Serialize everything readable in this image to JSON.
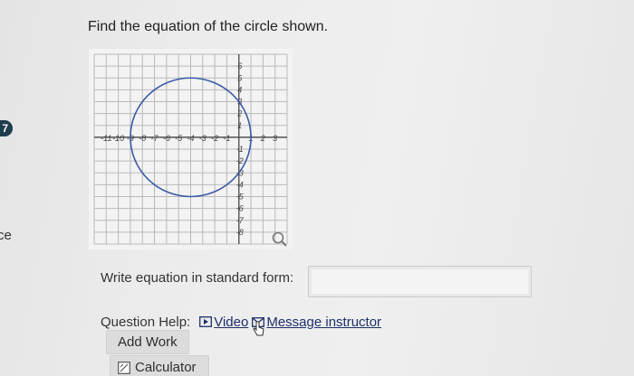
{
  "side_badge": "7",
  "side_text": "ce",
  "question": {
    "title": "Find the equation of the circle shown."
  },
  "graph": {
    "x_ticks": [
      "-11",
      "-10",
      "-9",
      "-8",
      "-7",
      "-6",
      "-5",
      "-4",
      "-3",
      "-2",
      "-1",
      "1",
      "2",
      "3"
    ],
    "y_ticks": [
      "6",
      "5",
      "4",
      "3",
      "2",
      "1",
      "-1",
      "-2",
      "-3",
      "-4",
      "-5",
      "-6",
      "-7",
      "-8"
    ],
    "xlim": [
      -12,
      4
    ],
    "ylim": [
      -9,
      7
    ],
    "circle": {
      "center_x": -4,
      "center_y": 0,
      "radius": 5,
      "color": "#3b5aa8"
    },
    "grid": true
  },
  "answer": {
    "label": "Write equation in standard form:",
    "value": ""
  },
  "help": {
    "label": "Question Help:",
    "video_label": "Video",
    "message_label": "Message instructor"
  },
  "buttons": {
    "add_work": "Add Work",
    "calculator": "Calculator"
  },
  "icons": {
    "video": "play-icon",
    "message": "envelope-icon",
    "calculator": "calculator-icon",
    "magnify": "magnify-icon",
    "cursor": "hand-pointer-icon"
  }
}
